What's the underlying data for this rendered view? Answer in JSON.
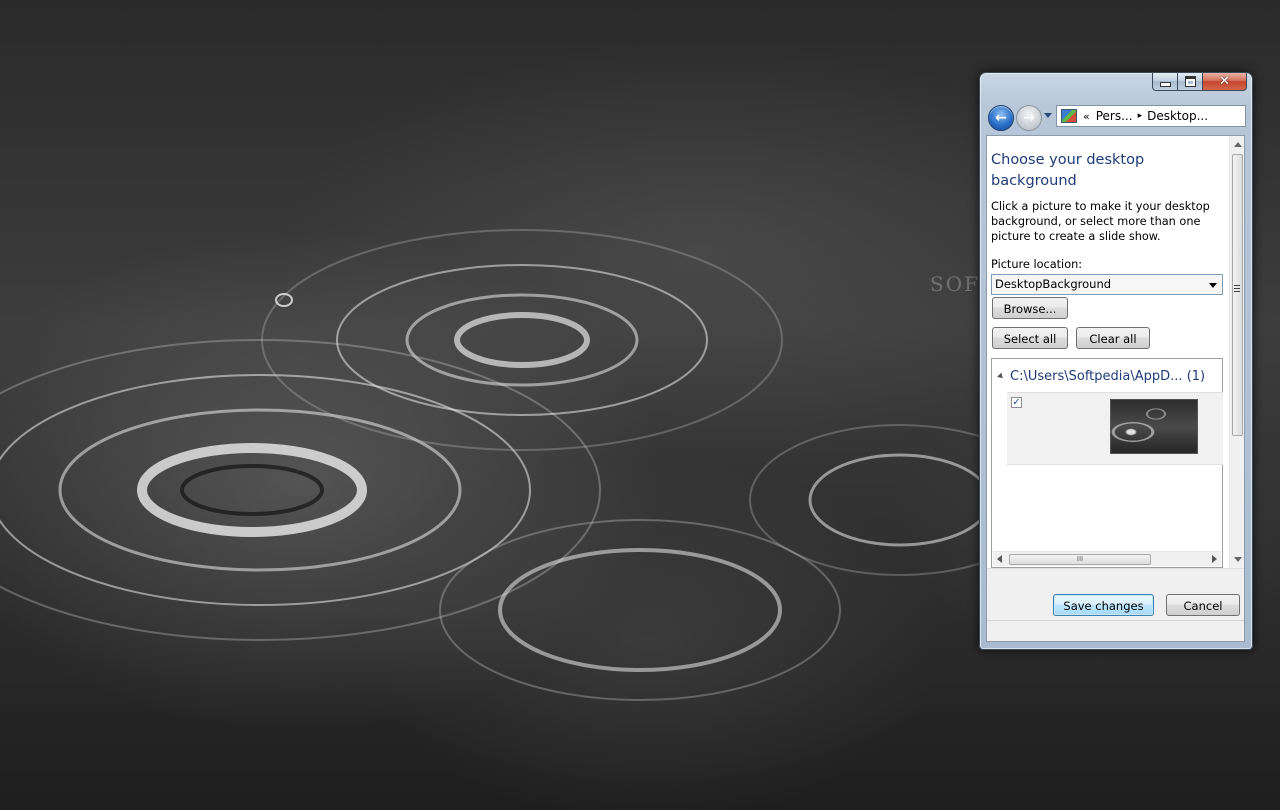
{
  "window": {
    "caption": {
      "minimize_glyph": "minimize-icon",
      "maximize_glyph": "maximize-icon",
      "close_glyph": "✕"
    },
    "address": {
      "overflow": "«",
      "crumb1": "Pers...",
      "crumb2": "Desktop...",
      "separator": "▸"
    },
    "heading": "Choose your desktop background",
    "description": "Click a picture to make it your desktop background, or select more than one picture to create a slide show.",
    "location_label": "Picture location:",
    "location_value": "DesktopBackground",
    "browse_label": "Browse...",
    "select_all_label": "Select all",
    "clear_all_label": "Clear all",
    "group": {
      "path": "C:\\Users\\Softpedia\\AppD...",
      "count": "(1)"
    },
    "item": {
      "checked": true,
      "check_glyph": "✓"
    },
    "hscroll_grip": "III",
    "save_label": "Save changes",
    "cancel_label": "Cancel"
  },
  "watermark": "SOFT",
  "colors": {
    "heading": "#1e3b7a",
    "accent": "#3c7fb1",
    "close": "#c5462c"
  }
}
